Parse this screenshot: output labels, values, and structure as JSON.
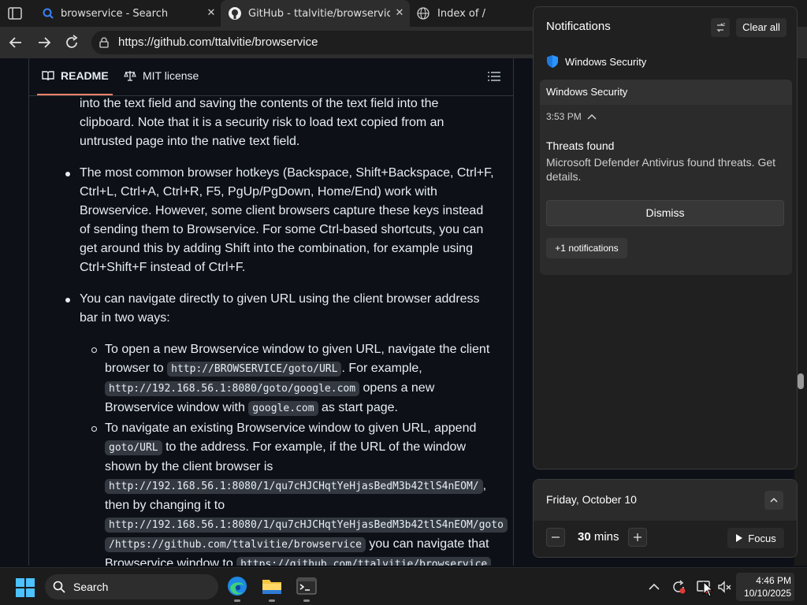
{
  "browser": {
    "tabs": [
      {
        "label": "browservice - Search",
        "icon": "search-icon"
      },
      {
        "label": "GitHub - ttalvitie/browservice: Browservice",
        "icon": "github-icon"
      },
      {
        "label": "Index of /",
        "icon": "globe-icon"
      }
    ],
    "url": "https://github.com/ttalvitie/browservice"
  },
  "readme": {
    "tabs": {
      "readme": "README",
      "license": "MIT license"
    },
    "para1": [
      "into the text field and saving the contents of the text field into the",
      "clipboard. Note that it is a security risk to load text copied from an",
      "untrusted page into the native text field."
    ],
    "para2": [
      "The most common browser hotkeys (Backspace, Shift+Backspace, Ctrl+F,",
      "Ctrl+L, Ctrl+A, Ctrl+R, F5, PgUp/PgDown, Home/End) work with",
      "Browservice. However, some client browsers capture these keys instead",
      "of sending them to Browservice. For some Ctrl-based shortcuts, you can",
      "get around this by adding Shift into the combination, for example using",
      "Ctrl+Shift+F instead of Ctrl+F."
    ],
    "para3": [
      "You can navigate directly to given URL using the client browser address",
      "bar in two ways:"
    ],
    "sub1": {
      "l1": "To open a new Browservice window to given URL, navigate the client",
      "l2a": "browser to ",
      "l2code": "http://BROWSERVICE/goto/URL",
      "l2b": ". For example,",
      "l3code": "http://192.168.56.1:8080/goto/google.com",
      "l3b": " opens a new",
      "l4a": "Browservice window with ",
      "l4code": "google.com",
      "l4b": " as start page."
    },
    "sub2": {
      "l1": "To navigate an existing Browservice window to given URL, append",
      "l2code": "goto/URL",
      "l2b": " to the address. For example, if the URL of the window",
      "l3": "shown by the client browser is",
      "l4code": "http://192.168.56.1:8080/1/qu7cHJCHqtYeHjasBedM3b42tlS4nEOM/",
      "l4b": ",",
      "l5": "then by changing it to",
      "l6code": "http://192.168.56.1:8080/1/qu7cHJCHqtYeHjasBedM3b42tlS4nEOM/goto",
      "l7code": "/https://github.com/ttalvitie/browservice",
      "l7b": " you can navigate that",
      "l8a": "Browservice window to ",
      "l8code": "https://github.com/ttalvitie/browservice"
    }
  },
  "notifications": {
    "title": "Notifications",
    "clear_all": "Clear all",
    "app_name": "Windows Security",
    "toast": {
      "source": "Windows Security",
      "time": "3:53 PM",
      "heading": "Threats found",
      "body": "Microsoft Defender Antivirus found threats. Get details.",
      "dismiss": "Dismiss",
      "more": "+1 notifications"
    }
  },
  "calendar": {
    "date": "Friday, October 10",
    "focus_value": "30",
    "focus_unit": "mins",
    "focus_label": "Focus"
  },
  "taskbar": {
    "search": "Search",
    "time": "4:46 PM",
    "date": "10/10/2025"
  },
  "colors": {
    "accent_underline": "#f78166",
    "shield": "#1f7ae0",
    "edge_blue": "#1e88e5",
    "folder_yellow": "#f4c542"
  }
}
